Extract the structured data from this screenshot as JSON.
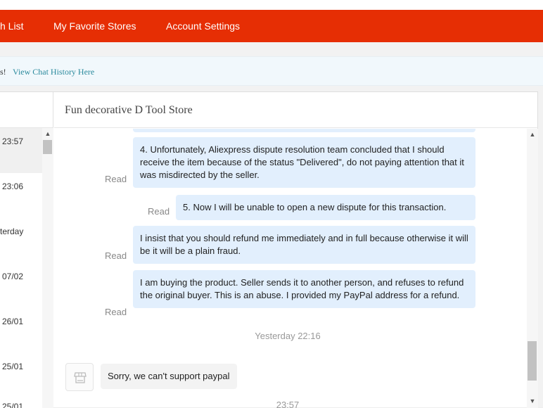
{
  "nav": {
    "items": [
      "h List",
      "My Favorite Stores",
      "Account Settings"
    ]
  },
  "notice": {
    "text": "s!",
    "link": "View Chat History Here"
  },
  "sidebar": {
    "conversations": [
      {
        "time": "23:57"
      },
      {
        "time": "23:06"
      },
      {
        "time": "terday"
      },
      {
        "time": "07/02"
      },
      {
        "time": "26/01"
      },
      {
        "time": "25/01"
      },
      {
        "time": "25/01"
      }
    ],
    "scroll_up_icon": "▲"
  },
  "chat": {
    "title": "Fun decorative D Tool Store",
    "messages": [
      {
        "read": "Read",
        "text": "4. Unfortunately, Aliexpress dispute resolution team concluded that I should receive the item because of the status \"Delivered\", do not paying attention that it was misdirected  by the seller."
      },
      {
        "read": "Read",
        "text": "5. Now I will be unable to open a new dispute for this transaction."
      },
      {
        "read": "Read",
        "text": "I insist that you should refund me immediately and in full because otherwise  it will be it will be a plain fraud."
      },
      {
        "read": "Read",
        "text": "I am buying the product. Seller sends it to another person, and refuses to refund the original buyer. This is an abuse. I provided my PayPal address for a refund."
      }
    ],
    "timestamp1": "Yesterday 22:16",
    "incoming": {
      "text": "Sorry, we can't support paypal",
      "avatar_icon": "store-icon"
    },
    "timestamp2": "23:57",
    "scroll_up_icon": "▲",
    "scroll_down_icon": "▼"
  },
  "colors": {
    "nav_bg": "#e62e04",
    "bubble_out": "#e2effd",
    "bubble_in": "#f3f3f3",
    "link": "#2b8a9d"
  }
}
